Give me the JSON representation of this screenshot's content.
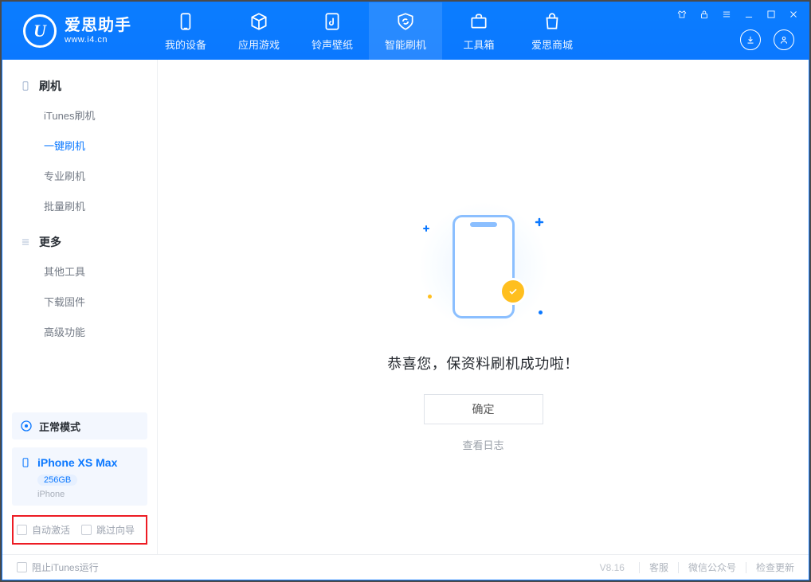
{
  "app": {
    "name_cn": "爱思助手",
    "url": "www.i4.cn"
  },
  "nav": {
    "tabs": [
      {
        "label": "我的设备"
      },
      {
        "label": "应用游戏"
      },
      {
        "label": "铃声壁纸"
      },
      {
        "label": "智能刷机"
      },
      {
        "label": "工具箱"
      },
      {
        "label": "爱思商城"
      }
    ],
    "active_index": 3
  },
  "sidebar": {
    "groups": [
      {
        "title": "刷机",
        "items": [
          "iTunes刷机",
          "一键刷机",
          "专业刷机",
          "批量刷机"
        ],
        "active_index": 1
      },
      {
        "title": "更多",
        "items": [
          "其他工具",
          "下载固件",
          "高级功能"
        ]
      }
    ],
    "status_label": "正常模式",
    "device": {
      "name": "iPhone XS Max",
      "storage": "256GB",
      "type": "iPhone"
    },
    "options": {
      "auto_activate": "自动激活",
      "skip_guide": "跳过向导"
    }
  },
  "main": {
    "success_message": "恭喜您，保资料刷机成功啦！",
    "ok_button": "确定",
    "view_log": "查看日志"
  },
  "footer": {
    "block_itunes": "阻止iTunes运行",
    "version": "V8.16",
    "links": [
      "客服",
      "微信公众号",
      "检查更新"
    ]
  }
}
